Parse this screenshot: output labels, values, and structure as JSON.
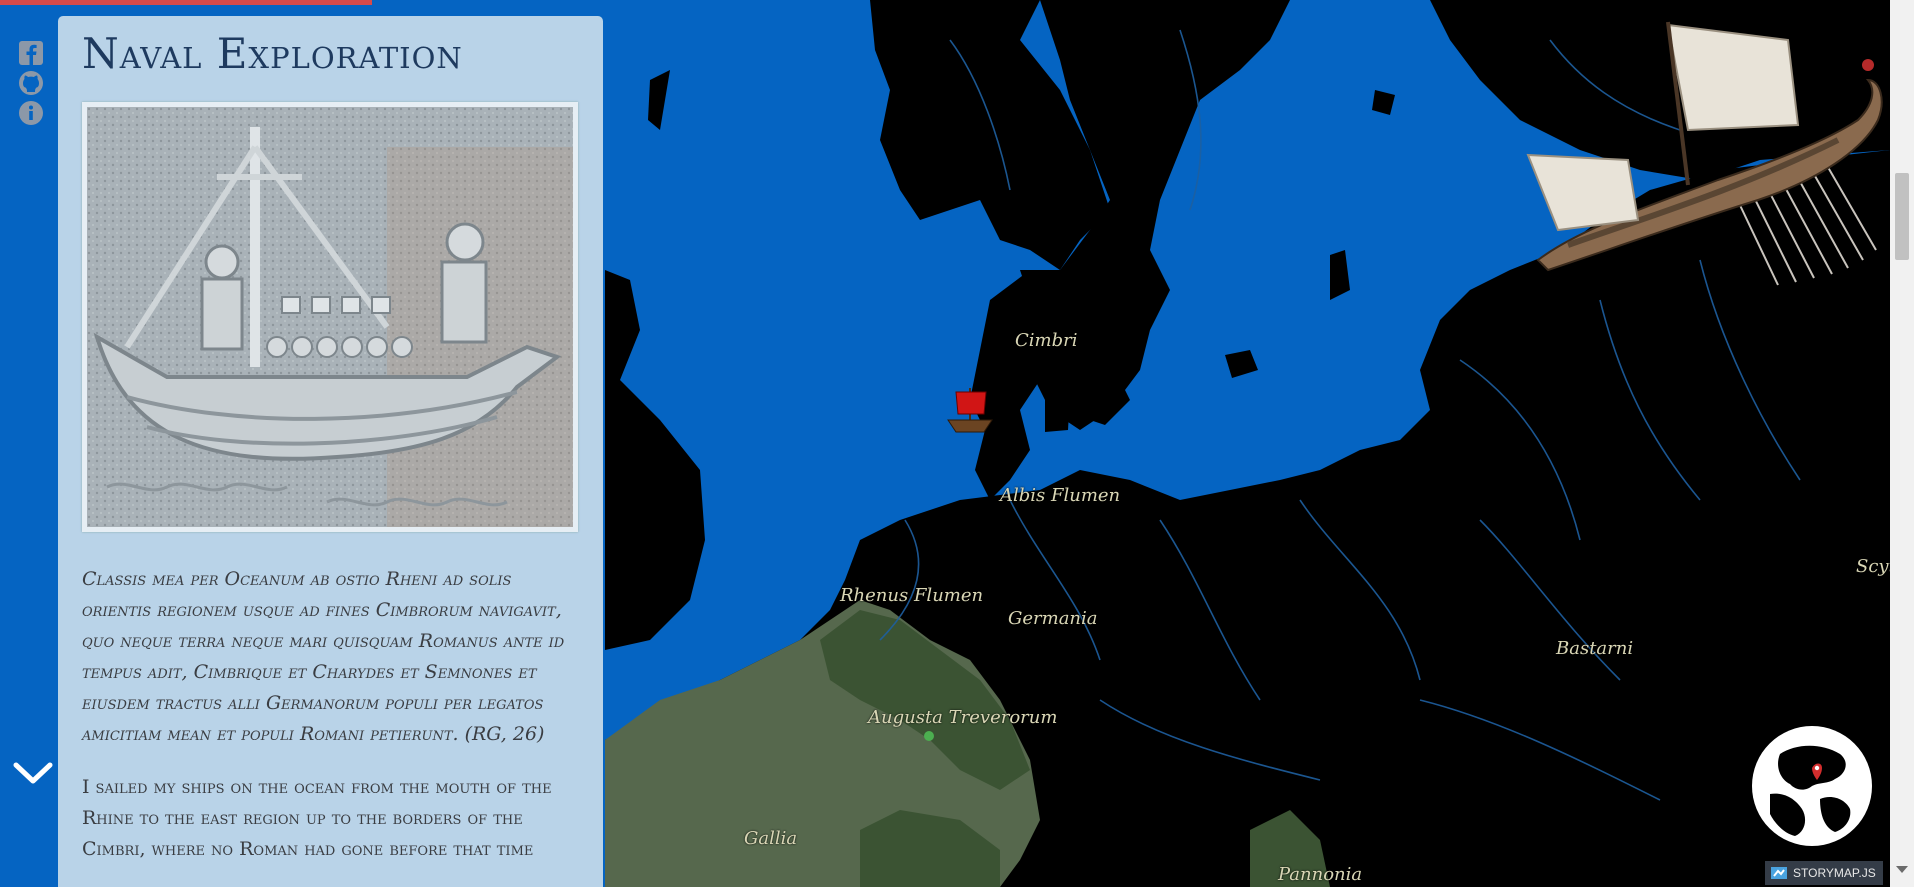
{
  "panel": {
    "title": "Naval Exploration",
    "latin": "Classis mea per Oceanum ab ostio Rheni ad solis orientis regionem usque ad fines Cimbrorum navigavit, quo neque terra neque mari quisquam Romanus ante id tempus adit, Cimbrique et Charydes et Semnones et eiusdem tractus alli Germanorum populi per legatos amicitiam mean et populi Romani petierunt. (RG, 26)",
    "english": "I sailed my ships on the ocean from the mouth of the Rhine to the east region up to the borders of the Cimbri, where no Roman had gone before that time"
  },
  "map": {
    "labels": {
      "cimbri": "Cimbri",
      "albis": "Albis Flumen",
      "rhenus": "Rhenus Flumen",
      "germania": "Germania",
      "bastarni": "Bastarni",
      "augusta": "Augusta Treverorum",
      "gallia": "Gallia",
      "pannonia": "Pannonia",
      "scyth": "Scyth"
    }
  },
  "social": {
    "icons": [
      "facebook-icon",
      "github-icon",
      "info-icon"
    ]
  },
  "attribution": {
    "label": "STORYMAP.JS"
  }
}
